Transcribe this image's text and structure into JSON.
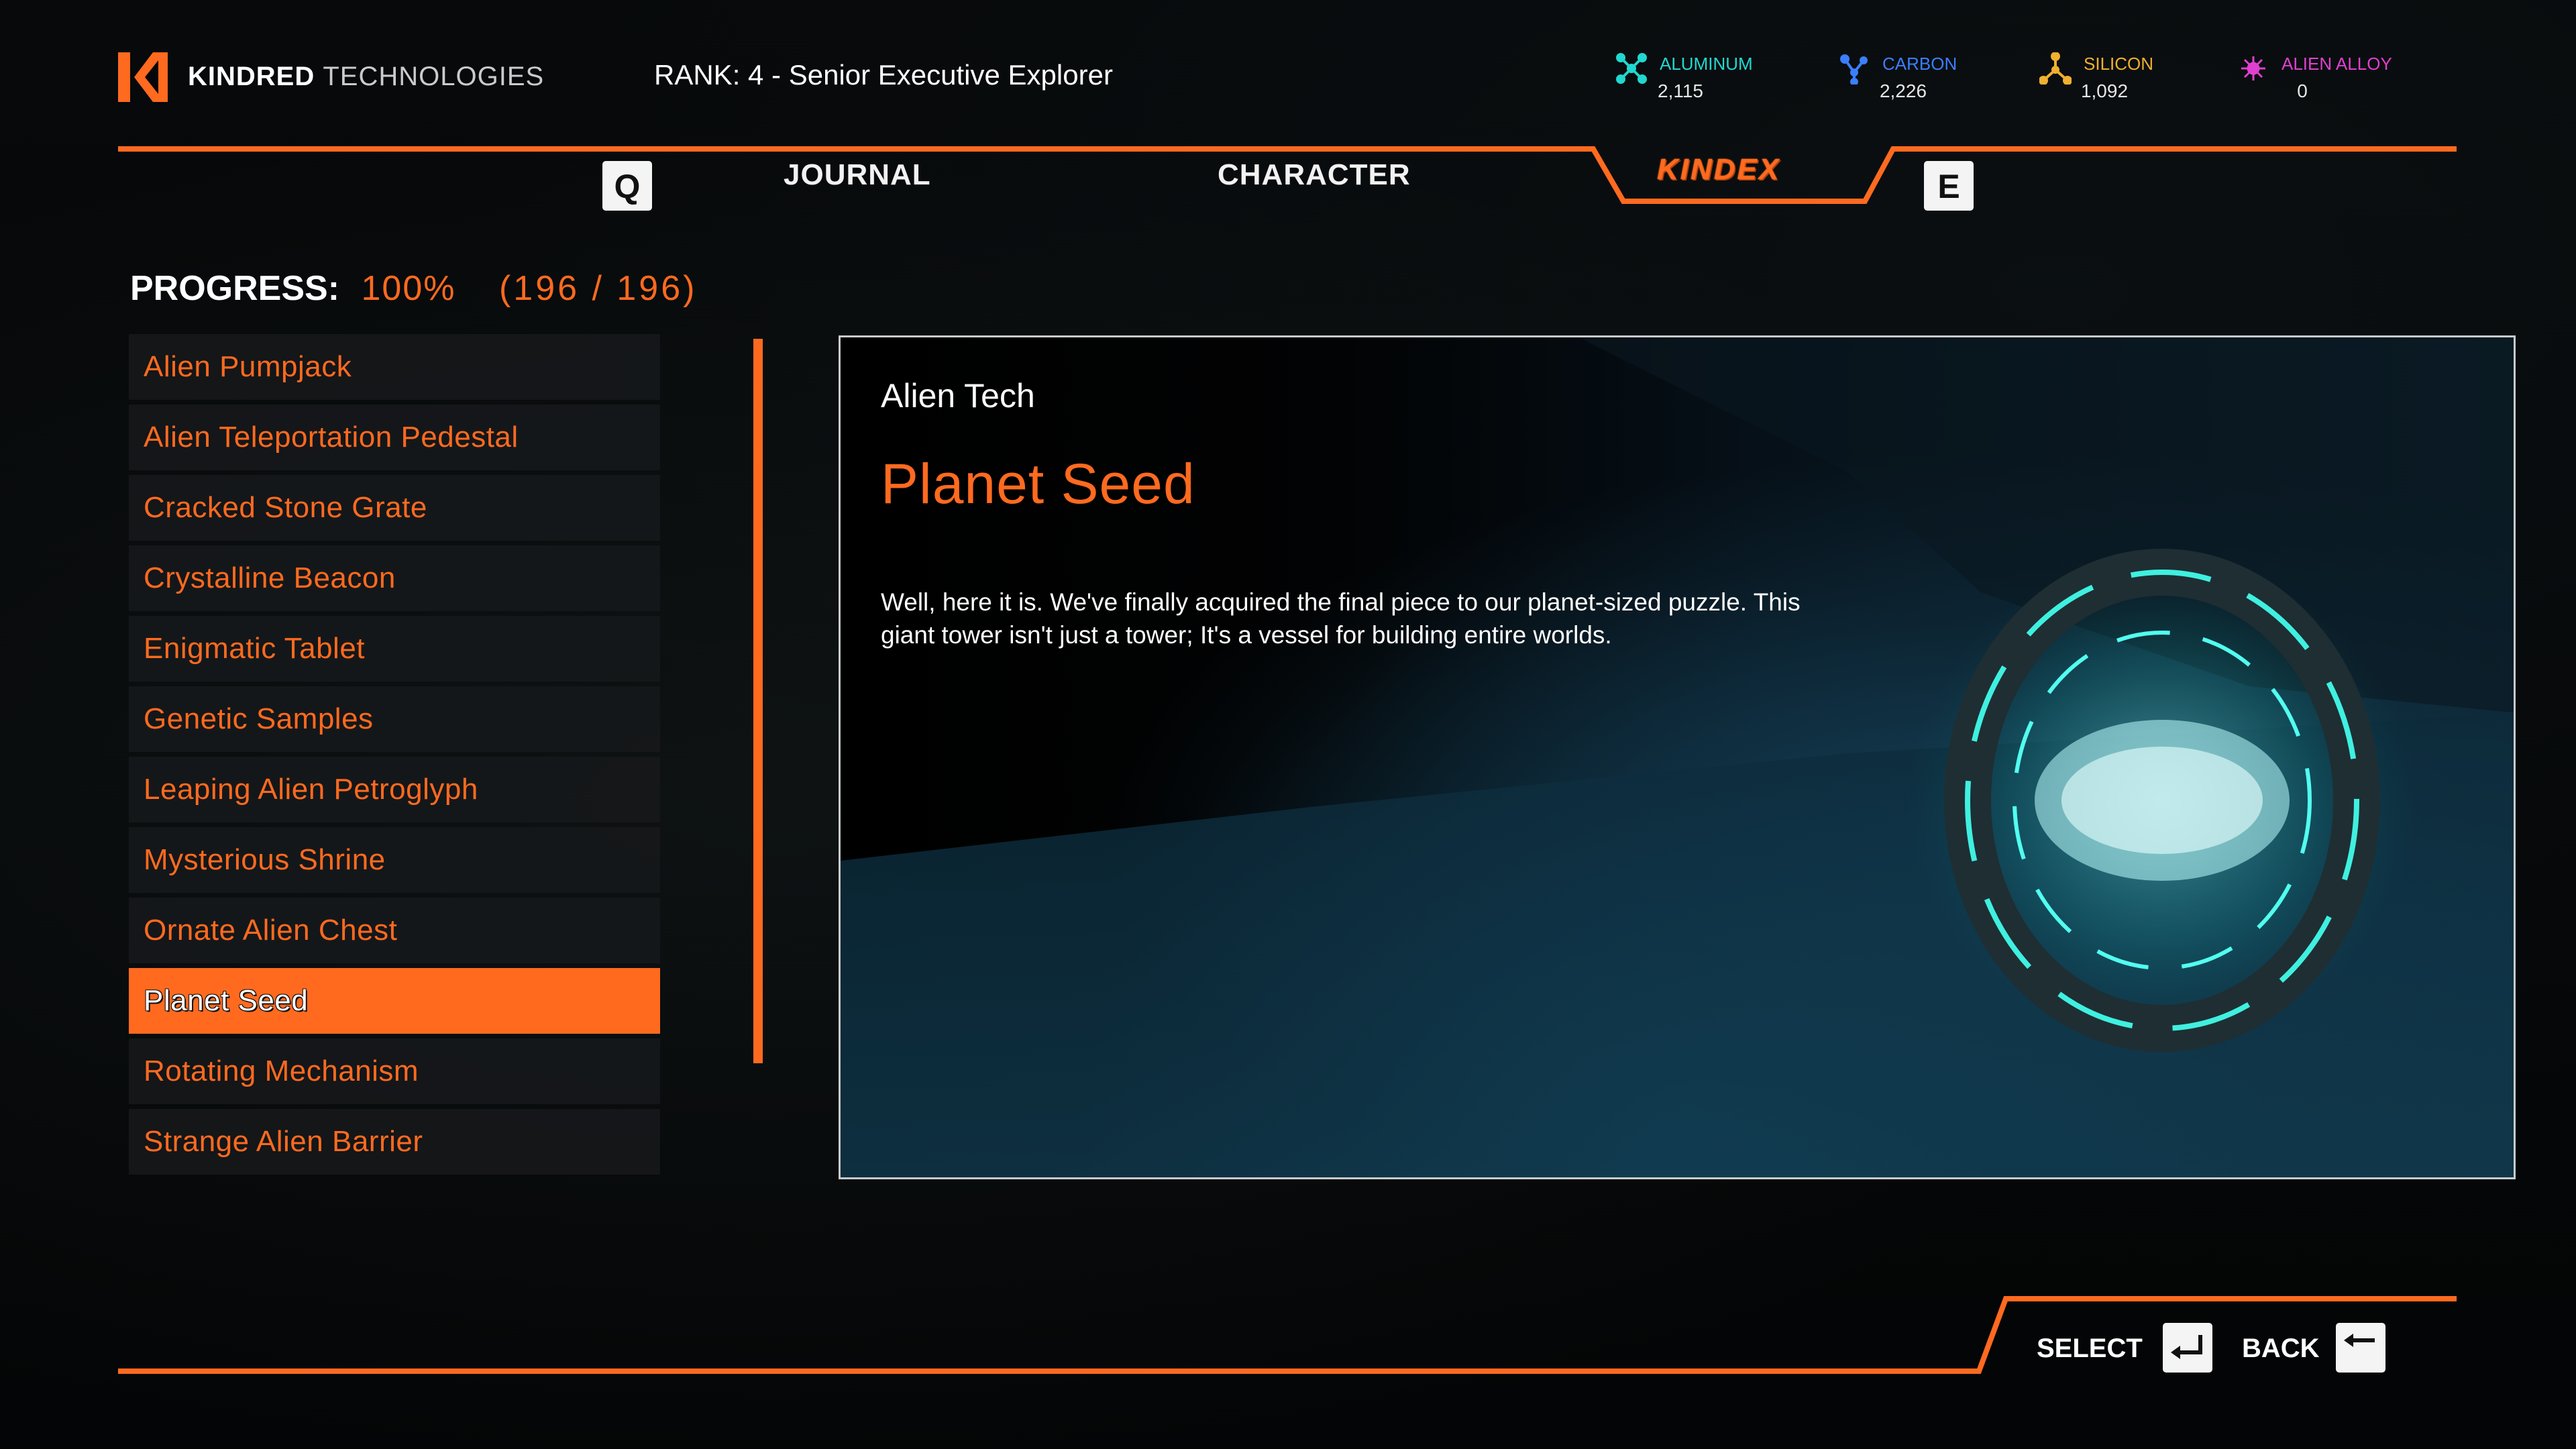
{
  "header": {
    "brand_primary": "KINDRED",
    "brand_secondary": "TECHNOLOGIES",
    "rank": "RANK:  4 - Senior Executive Explorer",
    "resources": [
      {
        "name": "ALUMINUM",
        "value": "2,115",
        "color": "#20d8d0",
        "icon": "aluminum-molecule-icon"
      },
      {
        "name": "CARBON",
        "value": "2,226",
        "color": "#3a7fff",
        "icon": "carbon-molecule-icon"
      },
      {
        "name": "SILICON",
        "value": "1,092",
        "color": "#f0b030",
        "icon": "silicon-molecule-icon"
      },
      {
        "name": "ALIEN ALLOY",
        "value": "0",
        "color": "#e040d0",
        "icon": "alien-alloy-icon"
      }
    ]
  },
  "tabs": {
    "prev_key": "Q",
    "next_key": "E",
    "items": [
      {
        "label": "JOURNAL",
        "active": false
      },
      {
        "label": "CHARACTER",
        "active": false
      },
      {
        "label": "KINDEX",
        "active": true
      }
    ]
  },
  "progress": {
    "label": "PROGRESS:",
    "percent": "100%",
    "count": "(196 / 196)"
  },
  "list": {
    "items": [
      "Alien Pumpjack",
      "Alien Teleportation Pedestal",
      "Cracked Stone Grate",
      "Crystalline Beacon",
      "Enigmatic Tablet",
      "Genetic Samples",
      "Leaping Alien Petroglyph",
      "Mysterious Shrine",
      "Ornate Alien Chest",
      "Planet Seed",
      "Rotating Mechanism",
      "Strange Alien Barrier"
    ],
    "selected_index": 9
  },
  "detail": {
    "category": "Alien Tech",
    "title": "Planet Seed",
    "description": "Well, here it is. We've finally acquired the final piece to our planet-sized puzzle. This giant tower isn't just a tower; It's a vessel for building entire worlds."
  },
  "footer": {
    "select_label": "SELECT",
    "back_label": "BACK"
  },
  "colors": {
    "accent": "#ff6a1f",
    "panel": "#16181a"
  }
}
